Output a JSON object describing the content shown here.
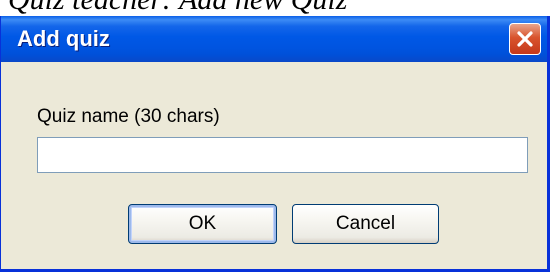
{
  "above_window": {
    "text": "Quiz teacher: Add new Quiz"
  },
  "dialog": {
    "title": "Add quiz",
    "field_label": "Quiz name (30 chars)",
    "quiz_name_value": "",
    "ok_label": "OK",
    "cancel_label": "Cancel"
  },
  "colors": {
    "titlebar": "#0058e6",
    "dialog_background": "#ece9d8",
    "close_button": "#d9542d",
    "input_border": "#7f9db9"
  },
  "icons": {
    "close": "close-icon"
  }
}
